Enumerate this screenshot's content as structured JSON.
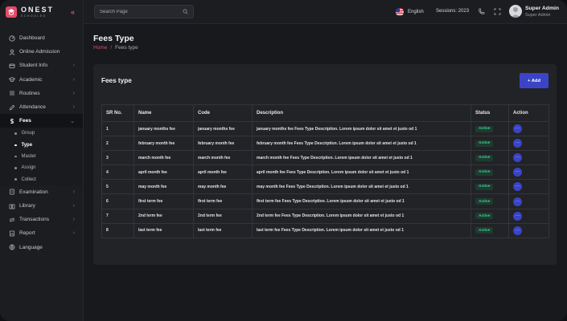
{
  "brand": {
    "title": "ONEST",
    "subtitle": "SCHOOLED"
  },
  "sidebar": {
    "items": [
      {
        "label": "Dashboard",
        "icon": "dashboard-icon",
        "chevron": false
      },
      {
        "label": "Online Admission",
        "icon": "user-icon",
        "chevron": false
      },
      {
        "label": "Student Info",
        "icon": "users-icon",
        "chevron": true
      },
      {
        "label": "Academic",
        "icon": "graduation-cap-icon",
        "chevron": true
      },
      {
        "label": "Routines",
        "icon": "list-icon",
        "chevron": true
      },
      {
        "label": "Attendance",
        "icon": "pencil-icon",
        "chevron": true
      },
      {
        "label": "Fees",
        "icon": "money-icon",
        "chevron": true,
        "active": true
      }
    ],
    "sub_items": [
      "Group",
      "Type",
      "Master",
      "Assign",
      "Collect"
    ],
    "active_sub": "Type",
    "items_after": [
      {
        "label": "Examination",
        "icon": "exam-icon"
      },
      {
        "label": "Library",
        "icon": "library-icon"
      },
      {
        "label": "Transactions",
        "icon": "transactions-icon"
      },
      {
        "label": "Report",
        "icon": "report-icon"
      },
      {
        "label": "Language",
        "icon": "language-icon"
      }
    ]
  },
  "header": {
    "search_placeholder": "Search Page",
    "language": "English",
    "session": "Sessions: 2023",
    "user_name": "Super Admin",
    "user_role": "Super Admin"
  },
  "page": {
    "title": "Fees Type",
    "breadcrumb_home": "Home",
    "breadcrumb_sep": "/",
    "breadcrumb_current": "Fees type"
  },
  "card": {
    "title": "Fees type",
    "add_label": "+ Add"
  },
  "table": {
    "columns": [
      "SR No.",
      "Name",
      "Code",
      "Description",
      "Status",
      "Action"
    ],
    "rows": [
      {
        "sr": "1",
        "name": "january months fee",
        "code": "january months fee",
        "description": "january months fee Fees Type Description. Lorem ipsum dolor sit amet et justo od 1",
        "status": "Active"
      },
      {
        "sr": "2",
        "name": "february month fee",
        "code": "february month fee",
        "description": "february month fee Fees Type Description. Lorem ipsum dolor sit amet et justo od 1",
        "status": "Active"
      },
      {
        "sr": "3",
        "name": "march month fee",
        "code": "march month fee",
        "description": "march month fee Fees Type Description. Lorem ipsum dolor sit amet et justo od 1",
        "status": "Active"
      },
      {
        "sr": "4",
        "name": "april month fee",
        "code": "april month fee",
        "description": "april month fee Fees Type Description. Lorem ipsum dolor sit amet et justo od 1",
        "status": "Active"
      },
      {
        "sr": "5",
        "name": "may month fee",
        "code": "may month fee",
        "description": "may month fee Fees Type Description. Lorem ipsum dolor sit amet et justo od 1",
        "status": "Active"
      },
      {
        "sr": "6",
        "name": "first term fee",
        "code": "first term fee",
        "description": "first term fee Fees Type Description. Lorem ipsum dolor sit amet et justo od 1",
        "status": "Active"
      },
      {
        "sr": "7",
        "name": "2nd term fee",
        "code": "2nd term fee",
        "description": "2nd term fee Fees Type Description. Lorem ipsum dolor sit amet et justo od 1",
        "status": "Active"
      },
      {
        "sr": "8",
        "name": "last term fee",
        "code": "last term fee",
        "description": "last term fee Fees Type Description. Lorem ipsum dolor sit amet et justo od 1",
        "status": "Active"
      }
    ],
    "action_glyph": "···"
  },
  "colors": {
    "accent": "#e34c6a",
    "primary_button": "#3b44c6",
    "status_active": "#3fcf8e"
  }
}
